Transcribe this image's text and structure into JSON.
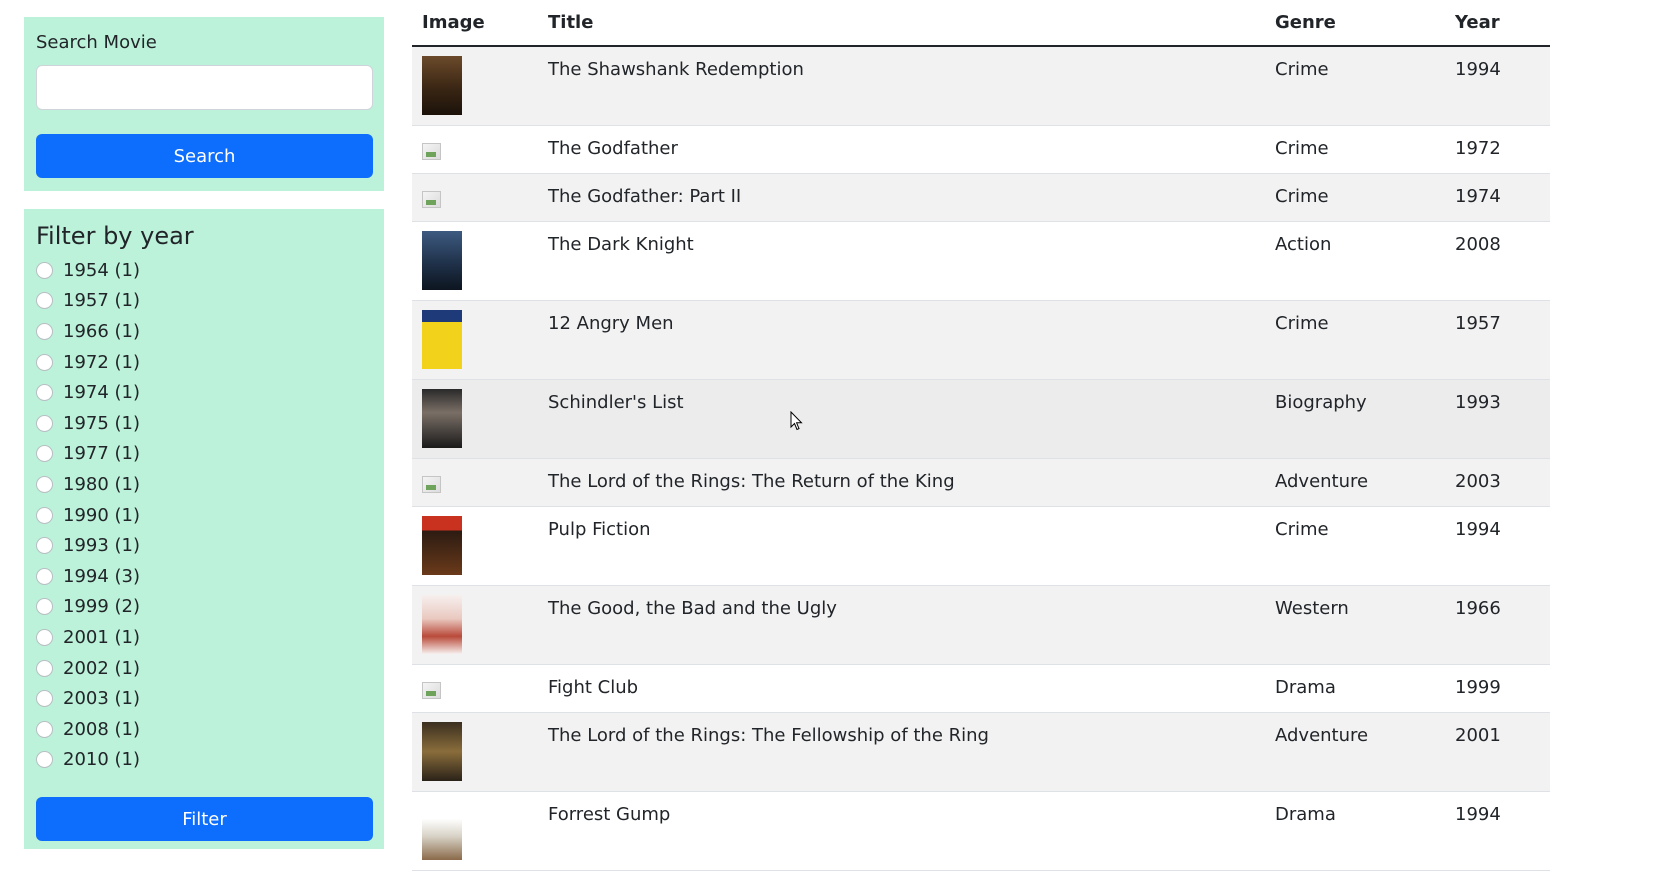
{
  "search": {
    "label": "Search Movie",
    "value": "",
    "placeholder": "",
    "button_label": "Search"
  },
  "filter": {
    "title": "Filter by year",
    "button_label": "Filter",
    "years": [
      "1954 (1)",
      "1957 (1)",
      "1966 (1)",
      "1972 (1)",
      "1974 (1)",
      "1975 (1)",
      "1977 (1)",
      "1980 (1)",
      "1990 (1)",
      "1993 (1)",
      "1994 (3)",
      "1999 (2)",
      "2001 (1)",
      "2002 (1)",
      "2003 (1)",
      "2008 (1)",
      "2010 (1)"
    ]
  },
  "table": {
    "headers": {
      "image": "Image",
      "title": "Title",
      "genre": "Genre",
      "year": "Year"
    },
    "rows": [
      {
        "title": "The Shawshank Redemption",
        "genre": "Crime",
        "year": "1994",
        "poster": "shawshank-poster"
      },
      {
        "title": "The Godfather",
        "genre": "Crime",
        "year": "1972",
        "poster": "broken-image"
      },
      {
        "title": "The Godfather: Part II",
        "genre": "Crime",
        "year": "1974",
        "poster": "broken-image"
      },
      {
        "title": "The Dark Knight",
        "genre": "Action",
        "year": "2008",
        "poster": "dark-knight-poster"
      },
      {
        "title": "12 Angry Men",
        "genre": "Crime",
        "year": "1957",
        "poster": "angry-men-poster"
      },
      {
        "title": "Schindler's List",
        "genre": "Biography",
        "year": "1993",
        "poster": "schindlers-list-poster"
      },
      {
        "title": "The Lord of the Rings: The Return of the King",
        "genre": "Adventure",
        "year": "2003",
        "poster": "broken-image"
      },
      {
        "title": "Pulp Fiction",
        "genre": "Crime",
        "year": "1994",
        "poster": "pulp-fiction-poster"
      },
      {
        "title": "The Good, the Bad and the Ugly",
        "genre": "Western",
        "year": "1966",
        "poster": "good-bad-ugly-poster"
      },
      {
        "title": "Fight Club",
        "genre": "Drama",
        "year": "1999",
        "poster": "broken-image"
      },
      {
        "title": "The Lord of the Rings: The Fellowship of the Ring",
        "genre": "Adventure",
        "year": "2001",
        "poster": "fellowship-poster"
      },
      {
        "title": "Forrest Gump",
        "genre": "Drama",
        "year": "1994",
        "poster": "forrest-gump-poster"
      }
    ]
  },
  "colors": {
    "sidebar_bg": "#bcf2d9",
    "primary_button": "#0d6efd",
    "striped_row": "#f2f2f2"
  }
}
